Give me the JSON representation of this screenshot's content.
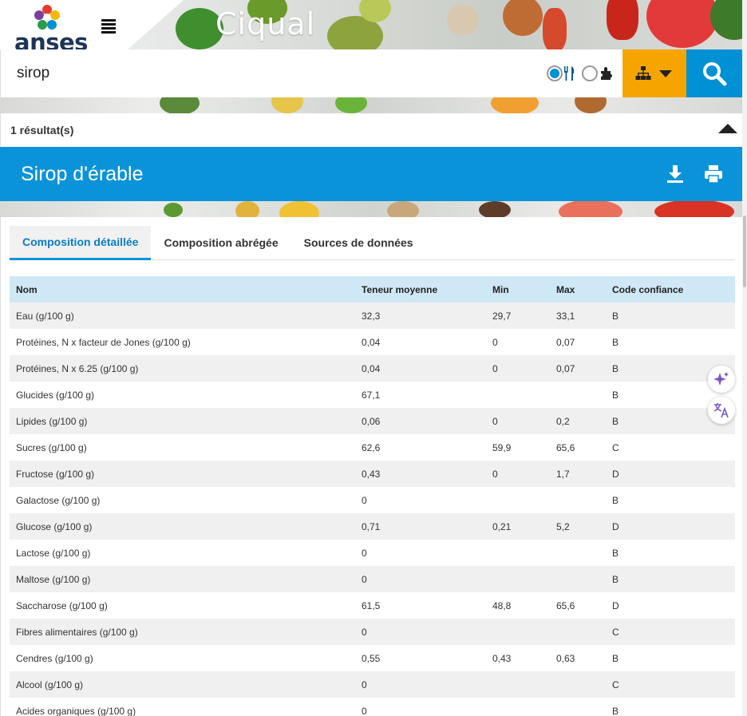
{
  "brand": {
    "name": "anses",
    "app_title": "Ciqual"
  },
  "search": {
    "query": "sirop"
  },
  "results": {
    "count_label": "1 résultat(s)"
  },
  "food": {
    "title": "Sirop d'érable"
  },
  "tabs": [
    {
      "label": "Composition détaillée",
      "active": true
    },
    {
      "label": "Composition abrégée",
      "active": false
    },
    {
      "label": "Sources de données",
      "active": false
    }
  ],
  "table": {
    "headers": [
      "Nom",
      "Teneur moyenne",
      "Min",
      "Max",
      "Code confiance"
    ],
    "rows": [
      [
        "Eau (g/100 g)",
        "32,3",
        "29,7",
        "33,1",
        "B"
      ],
      [
        "Protéines, N x facteur de Jones (g/100 g)",
        "0,04",
        "0",
        "0,07",
        "B"
      ],
      [
        "Protéines, N x 6.25 (g/100 g)",
        "0,04",
        "0",
        "0,07",
        "B"
      ],
      [
        "Glucides (g/100 g)",
        "67,1",
        "",
        "",
        "B"
      ],
      [
        "Lipides (g/100 g)",
        "0,06",
        "0",
        "0,2",
        "B"
      ],
      [
        "Sucres (g/100 g)",
        "62,6",
        "59,9",
        "65,6",
        "C"
      ],
      [
        "Fructose (g/100 g)",
        "0,43",
        "0",
        "1,7",
        "D"
      ],
      [
        "Galactose (g/100 g)",
        "0",
        "",
        "",
        "B"
      ],
      [
        "Glucose (g/100 g)",
        "0,71",
        "0,21",
        "5,2",
        "D"
      ],
      [
        "Lactose (g/100 g)",
        "0",
        "",
        "",
        "B"
      ],
      [
        "Maltose (g/100 g)",
        "0",
        "",
        "",
        "B"
      ],
      [
        "Saccharose (g/100 g)",
        "61,5",
        "48,8",
        "65,6",
        "D"
      ],
      [
        "Fibres alimentaires (g/100 g)",
        "0",
        "",
        "",
        "C"
      ],
      [
        "Cendres (g/100 g)",
        "0,55",
        "0,43",
        "0,63",
        "B"
      ],
      [
        "Alcool (g/100 g)",
        "0",
        "",
        "",
        "C"
      ],
      [
        "Acides organiques (g/100 g)",
        "0",
        "",
        "",
        "B"
      ]
    ]
  },
  "icons": {
    "menu": "menu-icon",
    "food_mode": "utensils-icon",
    "component_mode": "puzzle-icon",
    "tree": "sitemap-icon",
    "search": "search-icon",
    "download": "download-icon",
    "print": "print-icon",
    "collapse": "caret-up-icon",
    "ai": "sparkle-icon",
    "translate": "translate-icon"
  },
  "colors": {
    "primary": "#0a93d8",
    "accent": "#f6a500",
    "header_row": "#cfe8f5"
  }
}
